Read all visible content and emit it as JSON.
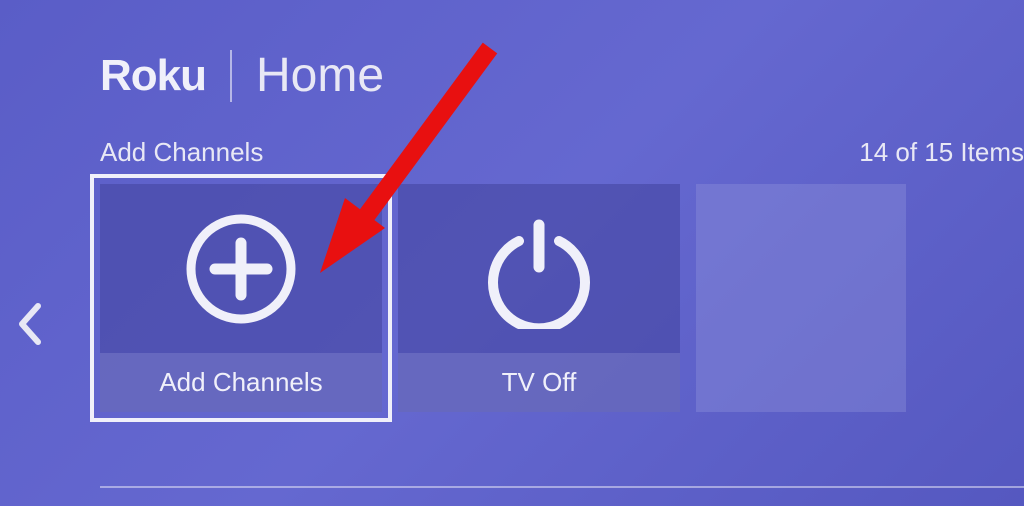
{
  "header": {
    "logo_text": "Roku",
    "page_title": "Home"
  },
  "section": {
    "label": "Add Channels",
    "item_count": "14 of 15 Items"
  },
  "tiles": [
    {
      "label": "Add Channels",
      "icon": "plus-circle",
      "selected": true
    },
    {
      "label": "TV Off",
      "icon": "power",
      "selected": false
    }
  ]
}
